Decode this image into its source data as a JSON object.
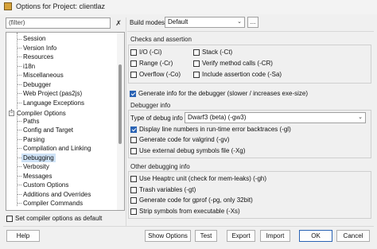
{
  "window": {
    "title": "Options for Project: clientlaz"
  },
  "filter": {
    "value": "(filter)"
  },
  "tree": {
    "items": [
      {
        "label": "Session"
      },
      {
        "label": "Version Info"
      },
      {
        "label": "Resources"
      },
      {
        "label": "i18n"
      },
      {
        "label": "Miscellaneous"
      },
      {
        "label": "Debugger"
      },
      {
        "label": "Web Project (pas2js)"
      },
      {
        "label": "Language Exceptions"
      },
      {
        "label": "Compiler Options",
        "expanded": true
      },
      {
        "label": "Paths"
      },
      {
        "label": "Config and Target"
      },
      {
        "label": "Parsing"
      },
      {
        "label": "Compilation and Linking"
      },
      {
        "label": "Debugging",
        "selected": true
      },
      {
        "label": "Verbosity"
      },
      {
        "label": "Messages"
      },
      {
        "label": "Custom Options"
      },
      {
        "label": "Additions and Overrides"
      },
      {
        "label": "Compiler Commands"
      }
    ],
    "expander_symbol": "−"
  },
  "set_compiler_options": {
    "label": "Set compiler options as default",
    "checked": false
  },
  "build_modes": {
    "label": "Build modes",
    "value": "Default",
    "ellipsis": "..."
  },
  "checks": {
    "title": "Checks and assertion",
    "items": [
      {
        "label": "I/O (-Ci)",
        "checked": false
      },
      {
        "label": "Range (-Cr)",
        "checked": false
      },
      {
        "label": "Overflow (-Co)",
        "checked": false
      },
      {
        "label": "Stack (-Ct)",
        "checked": false
      },
      {
        "label": "Verify method calls (-CR)",
        "checked": false
      },
      {
        "label": "Include assertion code (-Sa)",
        "checked": false
      }
    ]
  },
  "generate_debug_info": {
    "label": "Generate info for the debugger (slower / increases exe-size)",
    "checked": true
  },
  "debugger_info": {
    "title": "Debugger info",
    "type_label": "Type of debug info",
    "type_value": "Dwarf3 (beta) (-gw3)",
    "items": [
      {
        "label": "Display line numbers in run-time error backtraces (-gl)",
        "checked": true
      },
      {
        "label": "Generate code for valgrind (-gv)",
        "checked": false
      },
      {
        "label": "Use external debug symbols file (-Xg)",
        "checked": false
      }
    ]
  },
  "other_debugging": {
    "title": "Other debugging info",
    "items": [
      {
        "label": "Use Heaptrc unit (check for mem-leaks) (-gh)",
        "checked": false
      },
      {
        "label": "Trash variables (-gt)",
        "checked": false
      },
      {
        "label": "Generate code for gprof (-pg, only 32bit)",
        "checked": false
      },
      {
        "label": "Strip symbols from executable (-Xs)",
        "checked": false
      }
    ]
  },
  "buttons": {
    "help": "Help",
    "show_options": "Show Options",
    "test": "Test",
    "export": "Export",
    "import": "Import",
    "ok": "OK",
    "cancel": "Cancel"
  },
  "colors": {
    "selection": "#cfe3f7",
    "accent": "#2a63b4"
  }
}
